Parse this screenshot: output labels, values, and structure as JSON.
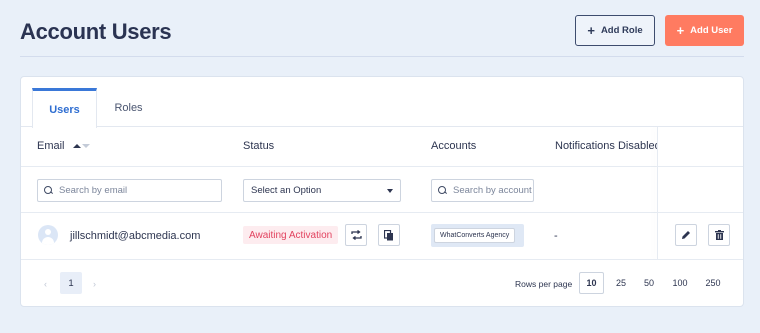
{
  "header": {
    "title": "Account Users",
    "add_role_label": "Add Role",
    "add_user_label": "Add User",
    "plus_glyph": "+"
  },
  "tabs": [
    {
      "label": "Users",
      "active": true
    },
    {
      "label": "Roles",
      "active": false
    }
  ],
  "table": {
    "columns": {
      "email": "Email",
      "status": "Status",
      "accounts": "Accounts",
      "notifications": "Notifications Disabled"
    },
    "filters": {
      "email_placeholder": "Search by email",
      "status_select_value": "Select an Option",
      "accounts_placeholder": "Search by account name"
    },
    "rows": [
      {
        "email": "jillschmidt@abcmedia.com",
        "status": "Awaiting Activation",
        "account": "WhatConverts Agency",
        "notifications_disabled": "-"
      }
    ]
  },
  "pagination": {
    "prev_glyph": "‹",
    "next_glyph": "›",
    "current_page": "1",
    "rows_per_page_label": "Rows per page",
    "rows_per_page_options": [
      "10",
      "25",
      "50",
      "100",
      "250"
    ],
    "rows_per_page_selected": "10"
  },
  "colors": {
    "page_bg": "#e9f0f9",
    "primary_blue": "#3a78d8",
    "accent_orange": "#ff7b61",
    "status_pink": "#e2435f",
    "status_pink_bg": "#fdecef",
    "text_dark": "#2a3352"
  },
  "icons": [
    "plus-icon",
    "sort-asc-icon",
    "search-icon",
    "chevron-down-icon",
    "user-avatar-icon",
    "resend-icon",
    "copy-icon",
    "edit-icon",
    "delete-icon",
    "chevron-left-icon",
    "chevron-right-icon"
  ]
}
